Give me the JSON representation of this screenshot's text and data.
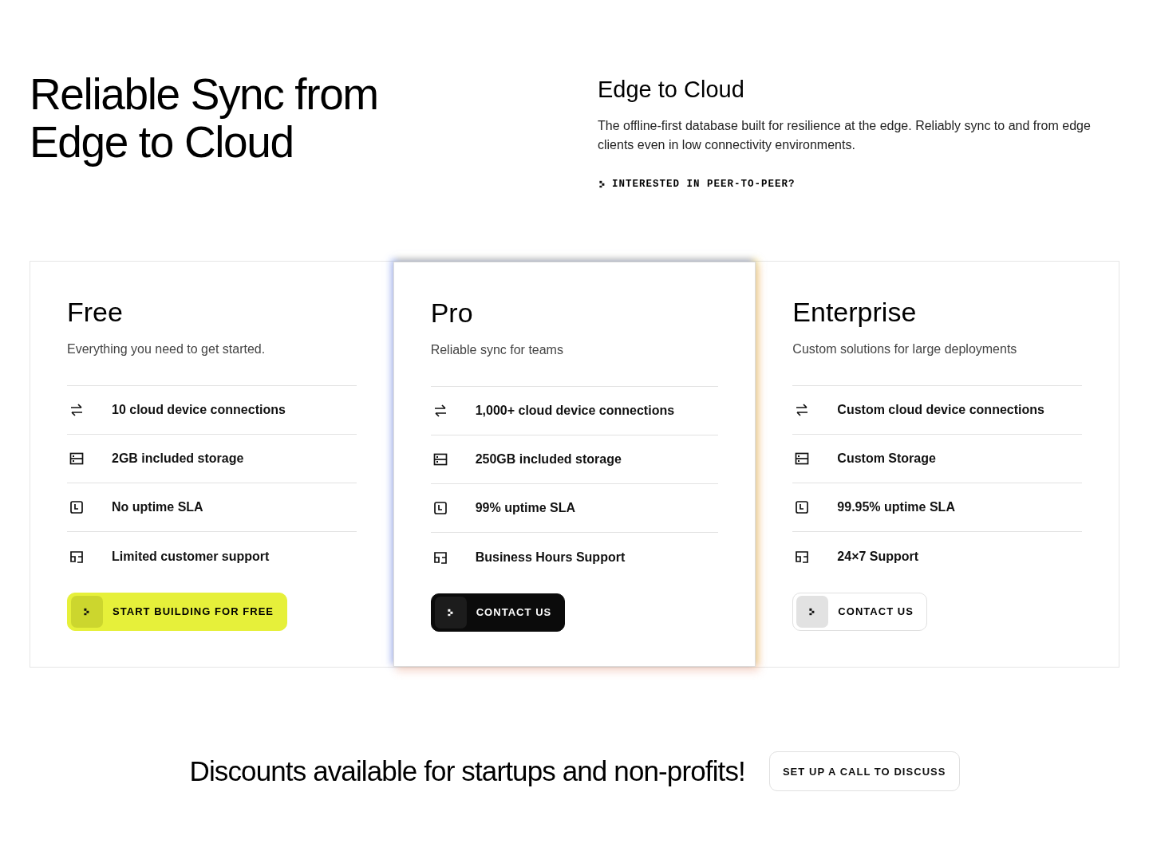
{
  "hero": {
    "title_lines": [
      "Reliable Sync from",
      "Edge to Cloud"
    ],
    "subtitle": "Edge to Cloud",
    "description": "The offline-first database built for resilience at the edge. Reliably sync to and from edge clients even in low connectivity environments.",
    "link": "INTERESTED IN PEER-TO-PEER?"
  },
  "plans": [
    {
      "name": "Free",
      "tagline": "Everything you need to get started.",
      "highlighted": false,
      "features": [
        {
          "kind": "connections",
          "text": "10 cloud device connections"
        },
        {
          "kind": "storage",
          "text": "2GB included storage"
        },
        {
          "kind": "uptime",
          "text": "No uptime SLA"
        },
        {
          "kind": "support",
          "text": "Limited customer support"
        }
      ],
      "button": {
        "kind": "primary",
        "label": "START BUILDING FOR FREE"
      }
    },
    {
      "name": "Pro",
      "tagline": "Reliable sync for teams",
      "highlighted": true,
      "features": [
        {
          "kind": "connections",
          "text": "1,000+ cloud device connections"
        },
        {
          "kind": "storage",
          "text": "250GB included storage"
        },
        {
          "kind": "uptime",
          "text": "99% uptime SLA"
        },
        {
          "kind": "support",
          "text": "Business Hours Support"
        }
      ],
      "button": {
        "kind": "dark",
        "label": "CONTACT US"
      }
    },
    {
      "name": "Enterprise",
      "tagline": "Custom solutions for large deployments",
      "highlighted": false,
      "features": [
        {
          "kind": "connections",
          "text": "Custom cloud device connections"
        },
        {
          "kind": "storage",
          "text": "Custom Storage"
        },
        {
          "kind": "uptime",
          "text": "99.95% uptime SLA"
        },
        {
          "kind": "support",
          "text": "24×7 Support"
        }
      ],
      "button": {
        "kind": "outline",
        "label": "CONTACT US"
      }
    }
  ],
  "discount": {
    "text": "Discounts available for startups and non-profits!",
    "button": "SET UP A CALL TO DISCUSS"
  }
}
